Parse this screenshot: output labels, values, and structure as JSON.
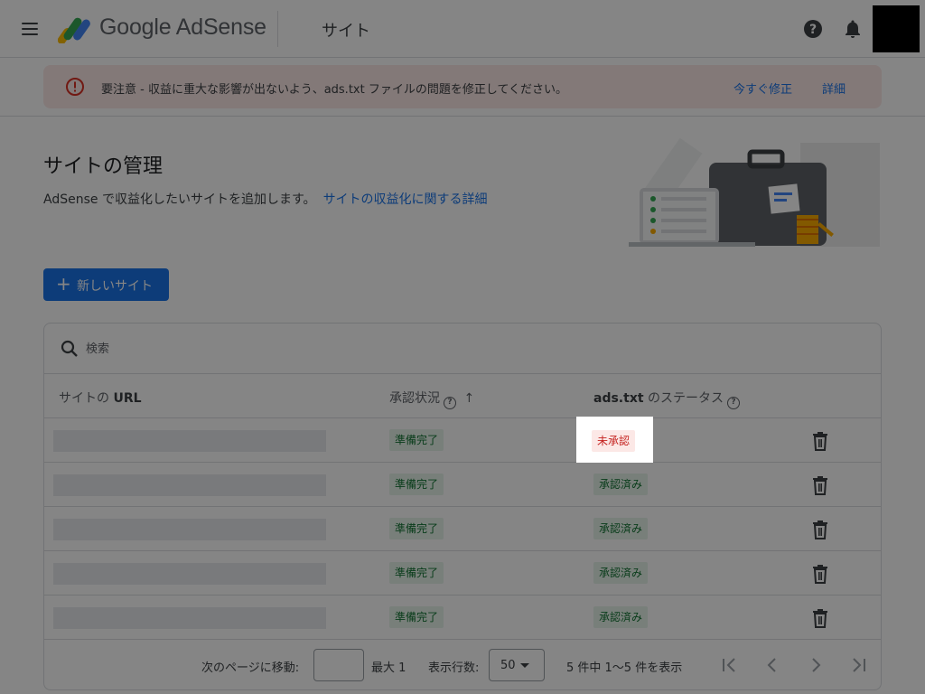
{
  "header": {
    "brand": "Google AdSense",
    "page_title": "サイト",
    "icons": [
      "menu-icon",
      "help-icon",
      "bell-icon"
    ]
  },
  "alert": {
    "text": "要注意 - 収益に重大な影響が出ないよう、ads.txt ファイルの問題を修正してください。",
    "fix_label": "今すぐ修正",
    "detail_label": "詳細",
    "icon": "error-icon"
  },
  "intro": {
    "title": "サイトの管理",
    "text": "AdSense で収益化したいサイトを追加します。",
    "link": "サイトの収益化に関する詳細"
  },
  "new_site_button": {
    "plus": "+",
    "label": "新しいサイト"
  },
  "search": {
    "placeholder": "検索"
  },
  "table": {
    "headers": {
      "url_prefix": "サイトの ",
      "url_bold": "URL",
      "approval": "承認状況",
      "ads_bold": "ads.txt",
      "ads_suffix": " のステータス",
      "help_mark": "?",
      "sort_arrow": "↑"
    },
    "rows": [
      {
        "approval": "準備完了",
        "ads": "未承認",
        "ads_status": "error"
      },
      {
        "approval": "準備完了",
        "ads": "承認済み",
        "ads_status": "ok"
      },
      {
        "approval": "準備完了",
        "ads": "承認済み",
        "ads_status": "ok"
      },
      {
        "approval": "準備完了",
        "ads": "承認済み",
        "ads_status": "ok"
      },
      {
        "approval": "準備完了",
        "ads": "承認済み",
        "ads_status": "ok"
      }
    ]
  },
  "footer": {
    "goto_label": "次のページに移動:",
    "max_label": "最大 1",
    "rows_label": "表示行数:",
    "rows_value": "50",
    "range": "5 件中 1〜5 件を表示"
  },
  "colors": {
    "accent": "#1a73e8",
    "ok_bg": "#e6f4ea",
    "ok_text": "#137333",
    "err_bg": "#fce8e6",
    "err_text": "#c5221f"
  }
}
